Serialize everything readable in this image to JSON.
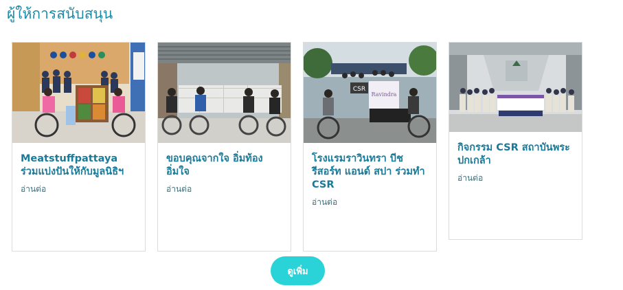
{
  "section": {
    "title": "ผู้ให้การสนับสนุน"
  },
  "cards": [
    {
      "title": "Meatstuffpattaya ร่วมแบ่งปันให้กับมูลนิธิฯ",
      "link_label": "อ่านต่อ"
    },
    {
      "title": "ขอบคุณจากใจ อิ่มท้อง อิ่มใจ",
      "link_label": "อ่านต่อ"
    },
    {
      "title": "โรงแรมราวินทรา บีช รีสอร์ท แอนด์ สปา ร่วมทำ CSR",
      "link_label": "อ่านต่อ",
      "photo_text": {
        "sign": "CSR",
        "banner": "Ravindra"
      }
    },
    {
      "title": "กิจกรรม CSR สถาบันพระปกเกล้า",
      "link_label": "อ่านต่อ"
    }
  ],
  "load_more": {
    "label": "ดูเพิ่ม"
  },
  "colors": {
    "title": "#1d8aa8",
    "card_title": "#1a7a99",
    "button": "#2ad3d8"
  }
}
